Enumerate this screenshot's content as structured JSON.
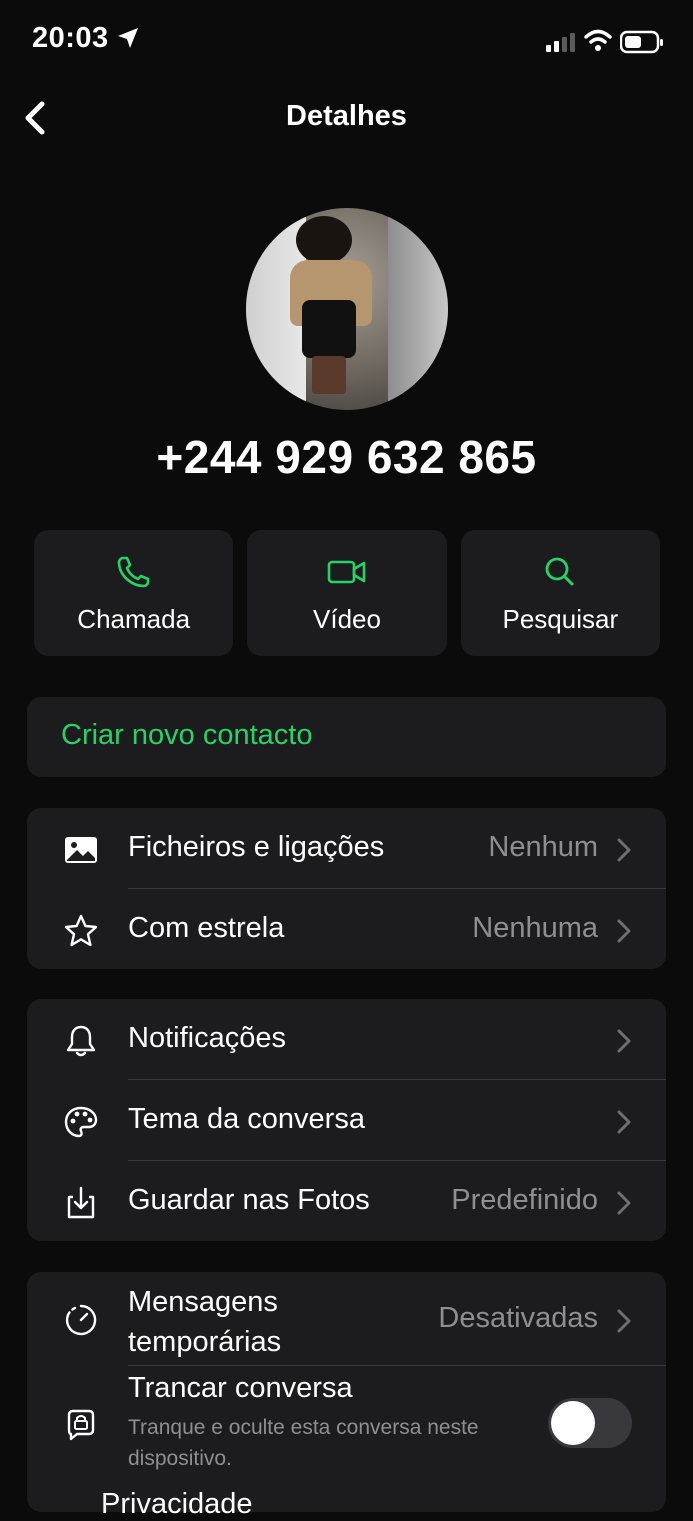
{
  "status_bar": {
    "time": "20:03"
  },
  "nav": {
    "title": "Detalhes"
  },
  "profile": {
    "phone": "+244 929 632 865"
  },
  "actions": [
    {
      "label": "Chamada",
      "icon": "phone-icon"
    },
    {
      "label": "Vídeo",
      "icon": "video-icon"
    },
    {
      "label": "Pesquisar",
      "icon": "search-icon"
    }
  ],
  "create_contact": {
    "label": "Criar novo contacto"
  },
  "media_group": {
    "files": {
      "label": "Ficheiros e ligações",
      "value": "Nenhum"
    },
    "starred": {
      "label": "Com estrela",
      "value": "Nenhuma"
    }
  },
  "settings_group": {
    "notifications": {
      "label": "Notificações"
    },
    "theme": {
      "label": "Tema da conversa"
    },
    "save_photos": {
      "label": "Guardar nas Fotos",
      "value": "Predefinido"
    }
  },
  "privacy_group": {
    "disappearing": {
      "label_line1": "Mensagens",
      "label_line2": "temporárias",
      "value": "Desativadas"
    },
    "lock": {
      "label": "Trancar conversa",
      "subtitle": "Tranque e oculte esta conversa neste dispositivo.",
      "enabled": false
    },
    "next_row_partial": "Privacidade"
  },
  "colors": {
    "accent": "#25d366",
    "card": "#1c1c1e",
    "background": "#0b0b0b",
    "secondary_text": "#8e8e93"
  }
}
